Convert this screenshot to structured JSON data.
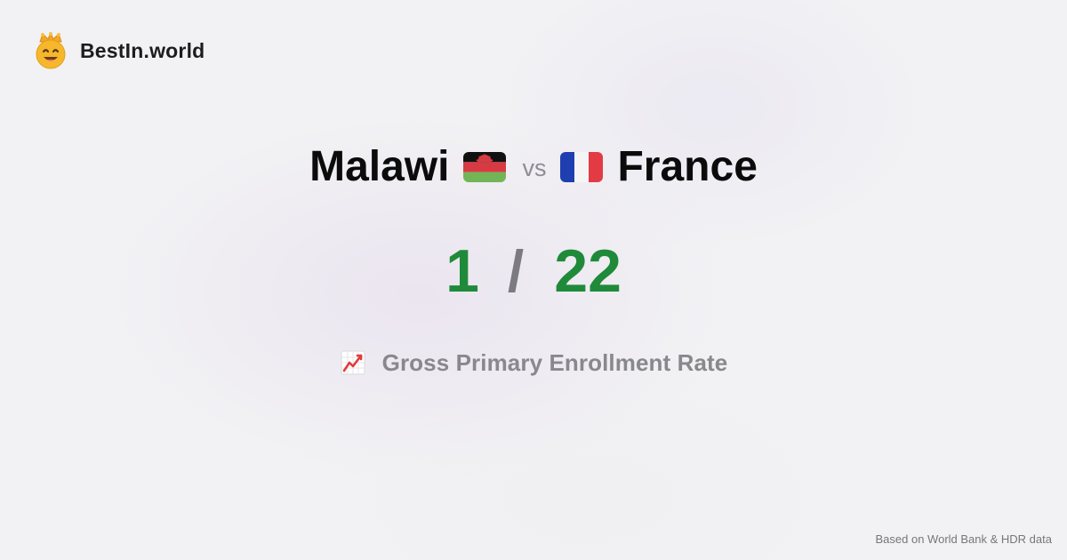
{
  "brand": {
    "name": "BestIn.world"
  },
  "comparison": {
    "country_a": "Malawi",
    "connector": "vs",
    "country_b": "France"
  },
  "ranks": {
    "country_a": "1",
    "separator": "/",
    "country_b": "22"
  },
  "metric": {
    "label": "Gross Primary Enrollment Rate",
    "icon": "chart-increasing-icon"
  },
  "footer": {
    "source": "Based on World Bank & HDR data"
  },
  "colors": {
    "rank": "#1f8a3a",
    "separator": "#7b7b80",
    "country_text": "#0b0b0c",
    "muted_text": "#88888d"
  }
}
